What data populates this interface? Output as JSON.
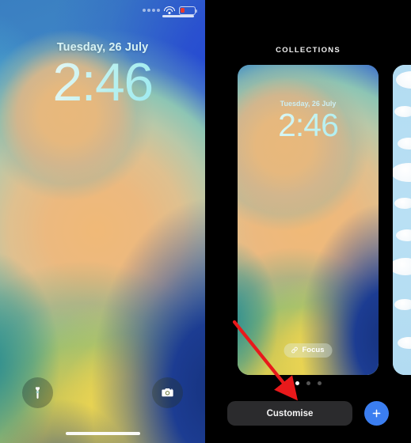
{
  "lock_screen": {
    "date": "Tuesday, 26 July",
    "time": "2:46",
    "status_bar": {
      "signal_icon": "signal-dots-icon",
      "wifi_icon": "wifi-icon",
      "battery_icon": "battery-low-icon",
      "battery_level_color": "#e8392f"
    },
    "controls": {
      "flashlight_icon": "flashlight-icon",
      "camera_icon": "camera-icon"
    },
    "home_indicator": "home-indicator"
  },
  "chooser": {
    "section_label": "COLLECTIONS",
    "cards": [
      {
        "name": "abstract-wallpaper-card",
        "date": "Tuesday, 26 July",
        "time": "2:46",
        "focus_label": "Focus",
        "focus_icon": "link-icon"
      },
      {
        "name": "clouds-wallpaper-card"
      }
    ],
    "page_dots": {
      "count": 3,
      "active_index": 0
    },
    "customise_label": "Customise",
    "add_icon": "plus-icon",
    "accent_color": "#3b7ef0",
    "button_color": "#2b2b2d"
  },
  "annotation": {
    "arrow_icon": "red-arrow-icon",
    "arrow_color": "#e8191b"
  }
}
